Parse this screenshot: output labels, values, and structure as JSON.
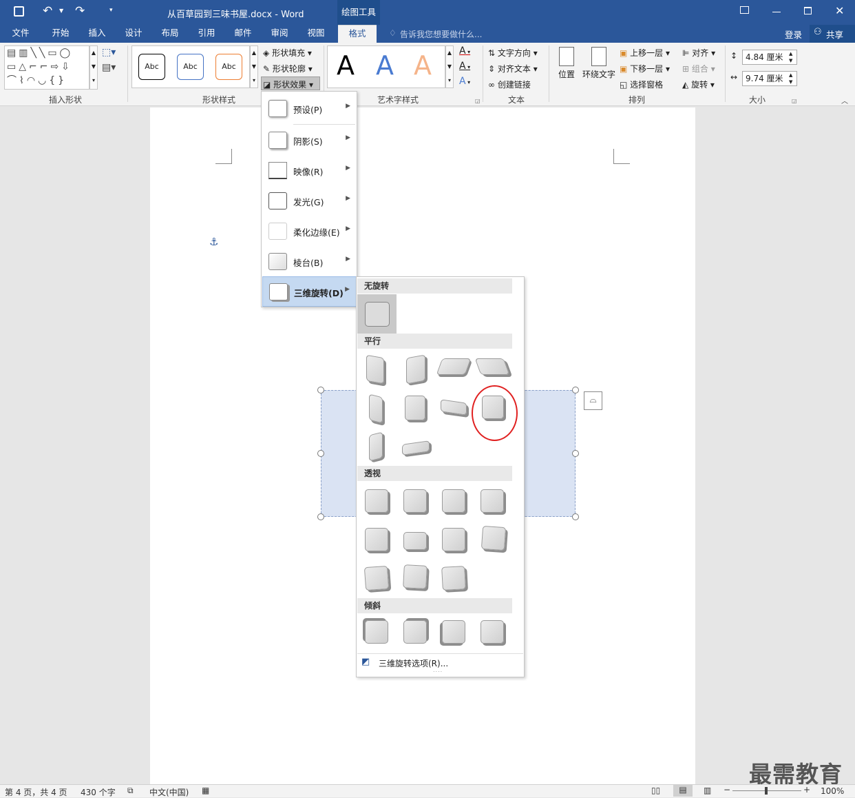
{
  "title": {
    "doc_title": "从百草园到三味书屋.docx - Word",
    "context_tab": "绘图工具"
  },
  "tabs": [
    "文件",
    "开始",
    "插入",
    "设计",
    "布局",
    "引用",
    "邮件",
    "审阅",
    "视图",
    "格式"
  ],
  "tell_me": "告诉我您想要做什么...",
  "login": "登录",
  "share": "共享",
  "ribbon": {
    "groups": [
      "插入形状",
      "形状样式",
      "艺术字样式",
      "文本",
      "排列",
      "大小"
    ],
    "shape_style_abc": [
      "Abc",
      "Abc",
      "Abc"
    ],
    "fill": "形状填充",
    "outline": "形状轮廓",
    "effects": "形状效果",
    "wordart_letters": [
      "A",
      "A",
      "A"
    ],
    "text_direction": "文字方向",
    "align_text": "对齐文本",
    "create_link": "创建链接",
    "position": "位置",
    "wrap_text": "环绕文字",
    "bring_forward": "上移一层",
    "send_backward": "下移一层",
    "selection_pane": "选择窗格",
    "align": "对齐",
    "group": "组合",
    "rotate": "旋转",
    "height": "4.84 厘米",
    "width": "9.74 厘米"
  },
  "effects_menu": [
    "预设(P)",
    "阴影(S)",
    "映像(R)",
    "发光(G)",
    "柔化边缘(E)",
    "棱台(B)",
    "三维旋转(D)"
  ],
  "rotation_menu": {
    "sections": [
      "无旋转",
      "平行",
      "透视",
      "倾斜"
    ],
    "options_label": "三维旋转选项(R)..."
  },
  "status": {
    "page": "第 4 页，共 4 页",
    "words": "430 个字",
    "lang": "中文(中国)",
    "zoom": "100%"
  },
  "watermark": "最需教育",
  "colors": {
    "accent": "#2b579a",
    "shape_fill": "#dae3f3",
    "highlight": "#e02020"
  }
}
